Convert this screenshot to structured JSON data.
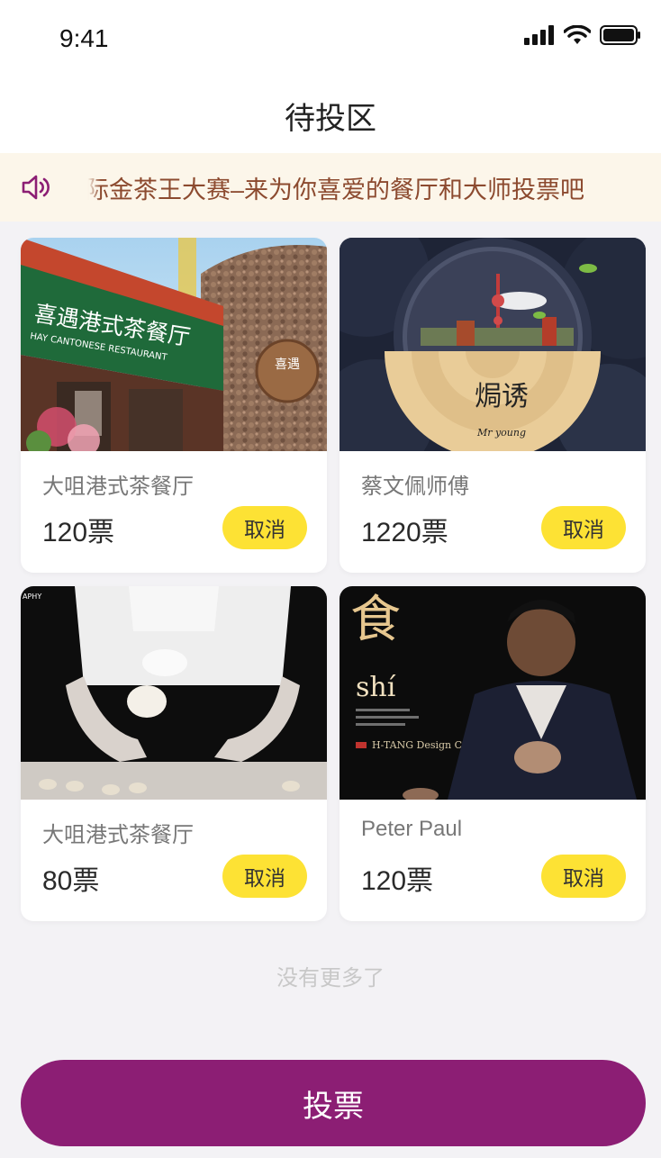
{
  "status_bar": {
    "time": "9:41",
    "icons": [
      "signal-icon",
      "wifi-icon",
      "battery-icon"
    ]
  },
  "header": {
    "title": "待投区"
  },
  "notice": {
    "icon": "speaker-icon",
    "text": "际金茶王大赛–来为你喜爱的餐厅和大师投票吧"
  },
  "cards": [
    {
      "name": "大咀港式茶餐厅",
      "votes": "120票",
      "cancel_label": "取消",
      "image": "restaurant-photo",
      "sign_text": "喜遇港式茶餐厅",
      "sign_subtext": "HAY CANTONESE RESTAURANT",
      "badge_text": "喜遇"
    },
    {
      "name": "蔡文佩师傅",
      "votes": "1220票",
      "cancel_label": "取消",
      "image": "dish-art-photo",
      "logo_text": "焗诱",
      "logo_sub": "Mr young"
    },
    {
      "name": "大咀港式茶餐厅",
      "votes": "80票",
      "cancel_label": "取消",
      "image": "dough-chef-photo",
      "corner_text": "APHY"
    },
    {
      "name": "Peter Paul",
      "votes": "120票",
      "cancel_label": "取消",
      "image": "chef-portrait-photo",
      "big_char": "食",
      "word": "shí",
      "caption": "H-TANG Design Center"
    }
  ],
  "footer": {
    "no_more_text": "没有更多了",
    "vote_label": "投票"
  },
  "colors": {
    "accent": "#8c1e74",
    "cancel_bg": "#fde234",
    "notice_bg": "#fcf6ea",
    "notice_text": "#8c4a2f"
  }
}
